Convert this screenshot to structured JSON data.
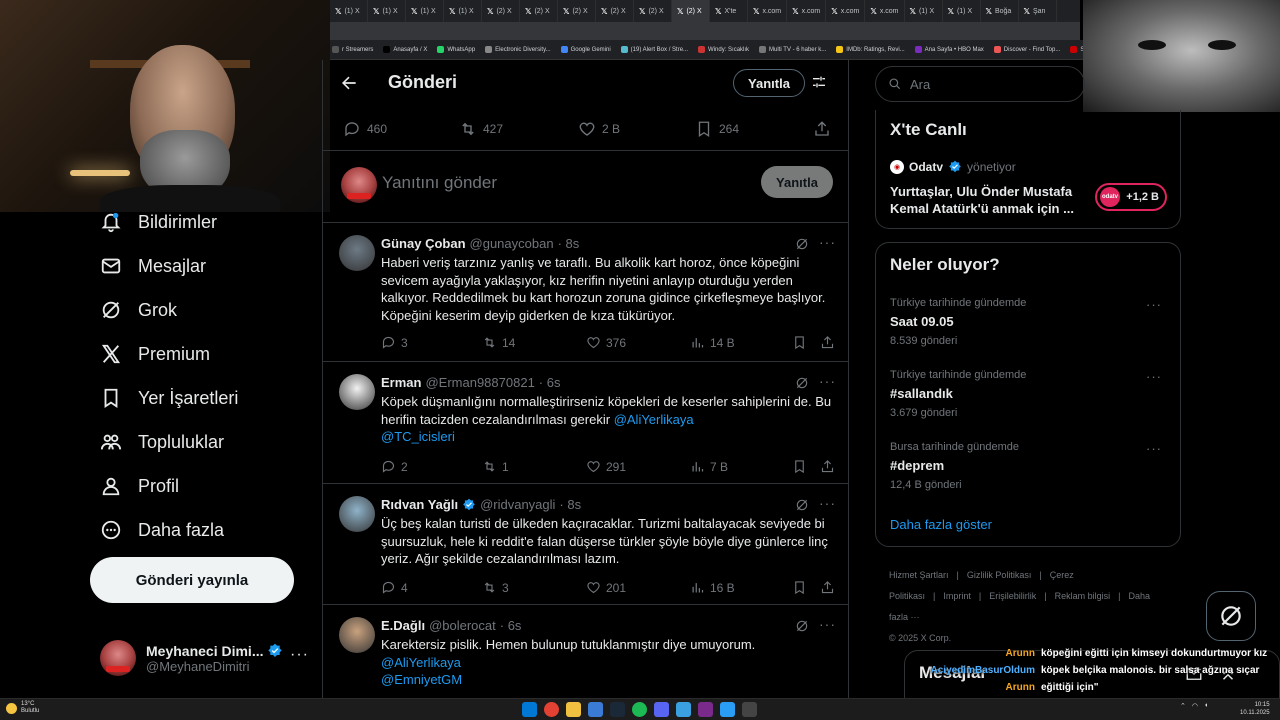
{
  "browser": {
    "tabs": [
      {
        "label": "(1) X",
        "active": false
      },
      {
        "label": "(1) X",
        "active": false
      },
      {
        "label": "(1) X",
        "active": false
      },
      {
        "label": "(1) X",
        "active": false
      },
      {
        "label": "(2) X",
        "active": false
      },
      {
        "label": "(2) X",
        "active": false
      },
      {
        "label": "(2) X",
        "active": false
      },
      {
        "label": "(2) X",
        "active": false
      },
      {
        "label": "(2) X",
        "active": false
      },
      {
        "label": "(2) X",
        "active": true
      },
      {
        "label": "X'te",
        "active": false
      },
      {
        "label": "x.com",
        "active": false
      },
      {
        "label": "x.com",
        "active": false
      },
      {
        "label": "x.com",
        "active": false
      },
      {
        "label": "x.com",
        "active": false
      },
      {
        "label": "(1) X",
        "active": false
      },
      {
        "label": "(1) X",
        "active": false
      },
      {
        "label": "Boğa",
        "active": false
      },
      {
        "label": "Şan",
        "active": false
      }
    ],
    "bookmarks": [
      {
        "label": "r Streamers",
        "color": "#555"
      },
      {
        "label": "Anasayfa / X",
        "color": "#000"
      },
      {
        "label": "WhatsApp",
        "color": "#25d366"
      },
      {
        "label": "Electronic Diversity...",
        "color": "#888"
      },
      {
        "label": "Google Gemini",
        "color": "#4285f4"
      },
      {
        "label": "(19) Alert Box / Stre...",
        "color": "#5bc"
      },
      {
        "label": "Windy: Sıcaklık",
        "color": "#c33"
      },
      {
        "label": "Multi TV - 6 haber k...",
        "color": "#777"
      },
      {
        "label": "IMDb: Ratings, Revi...",
        "color": "#f5c518"
      },
      {
        "label": "Ana Sayfa • HBO Max",
        "color": "#7b2cbf"
      },
      {
        "label": "Discover - Find Top...",
        "color": "#e55"
      },
      {
        "label": "SEÇİM S",
        "color": "#c00"
      }
    ]
  },
  "nav": {
    "items": [
      {
        "label": "Bildirimler",
        "icon": "bell-icon"
      },
      {
        "label": "Mesajlar",
        "icon": "mail-icon"
      },
      {
        "label": "Grok",
        "icon": "grok-icon"
      },
      {
        "label": "Premium",
        "icon": "x-logo-icon"
      },
      {
        "label": "Yer İşaretleri",
        "icon": "bookmark-icon"
      },
      {
        "label": "Topluluklar",
        "icon": "communities-icon"
      },
      {
        "label": "Profil",
        "icon": "profile-icon"
      },
      {
        "label": "Daha fazla",
        "icon": "more-circle-icon"
      }
    ],
    "post_button": "Gönderi yayınla",
    "account": {
      "name": "Meyhaneci Dimi...",
      "handle": "@MeyhaneDimitri"
    }
  },
  "header": {
    "title": "Gönderi",
    "reply_label": "Yanıtla"
  },
  "stats": {
    "replies": "460",
    "reposts": "427",
    "likes": "2 B",
    "bookmarks": "264"
  },
  "composer": {
    "placeholder": "Yanıtını gönder",
    "button": "Yanıtla"
  },
  "tweets": [
    {
      "name": "Günay Çoban",
      "handle": "@gunaycoban",
      "time": "· 8s",
      "verified": false,
      "text": "Haberi veriş tarzınız yanlış ve taraflı. Bu alkolik kart horoz, önce köpeğini sevicem ayağıyla yaklaşıyor, kız herifin niyetini anlayıp oturduğu yerden kalkıyor. Reddedilmek bu kart horozun zoruna gidince çirkefleşmeye başlıyor. Köpeğini keserim deyip giderken de kıza tükürüyor.",
      "mentions": [],
      "replies": "3",
      "reposts": "14",
      "likes": "376",
      "views": "14 B",
      "avatar_color": "#6d7a86"
    },
    {
      "name": "Erman",
      "handle": "@Erman98870821",
      "time": "· 6s",
      "verified": false,
      "text": "Köpek düşmanlığını normalleştirirseniz köpekleri de keserler sahiplerini de. Bu herifin tacizden cezalandırılması gerekir",
      "mentions": [
        "@AliYerlikaya",
        "@TC_icisleri"
      ],
      "replies": "2",
      "reposts": "1",
      "likes": "291",
      "views": "7 B",
      "avatar_color": "#f2f2f2"
    },
    {
      "name": "Rıdvan Yağlı",
      "handle": "@ridvanyagli",
      "time": "· 8s",
      "verified": true,
      "text": "Üç beş kalan turisti de ülkeden kaçıracaklar. Turizmi baltalayacak seviyede bi şuursuzluk, hele ki reddit'e falan düşerse türkler şöyle böyle diye günlerce linç yeriz. Ağır şekilde cezalandırılması lazım.",
      "mentions": [],
      "replies": "4",
      "reposts": "3",
      "likes": "201",
      "views": "16 B",
      "avatar_color": "#8fb3c9"
    },
    {
      "name": "E.Dağlı",
      "handle": "@bolerocat",
      "time": "· 6s",
      "verified": false,
      "text": "Karektersiz pislik. Hemen bulunup tutuklanmıştır diye umuyorum.",
      "mentions": [
        "@AliYerlikaya",
        "@EmniyetGM"
      ],
      "replies": "",
      "reposts": "",
      "likes": "",
      "views": "",
      "avatar_color": "#c9a27f"
    }
  ],
  "search": {
    "placeholder": "Ara"
  },
  "live": {
    "title": "X'te Canlı",
    "source": "Odatv",
    "role": "yönetiyor",
    "text": "Yurttaşlar, Ulu Önder Mustafa Kemal Atatürk'ü anmak için ...",
    "count": "+1,2 B",
    "logo_text": "odatv"
  },
  "trends": {
    "title": "Neler oluyor?",
    "items": [
      {
        "context": "Türkiye tarihinde gündemde",
        "title": "Saat 09.05",
        "count": "8.539 gönderi"
      },
      {
        "context": "Türkiye tarihinde gündemde",
        "title": "#sallandık",
        "count": "3.679 gönderi"
      },
      {
        "context": "Bursa tarihinde gündemde",
        "title": "#deprem",
        "count": "12,4 B gönderi"
      }
    ],
    "show_more": "Daha fazla göster"
  },
  "footer": {
    "links": [
      "Hizmet Şartları",
      "|",
      "Gizlilik Politikası",
      "|",
      "Çerez Politikası",
      "|",
      "Imprint",
      "|",
      "Erişilebilirlik",
      "|",
      "Reklam bilgisi",
      "|",
      "Daha fazla ···"
    ],
    "copyright": "© 2025 X Corp."
  },
  "messages_drawer": {
    "title": "Mesajlar"
  },
  "chat": [
    {
      "user": "Arunn",
      "msg": "köpeğini eğitti için kimseyi dokundurtmuyor kız",
      "color": "orange"
    },
    {
      "user": "AciyedimBasurOldum",
      "msg": "köpek belçika malonois. bir salsa ağzına sıçar",
      "color": "blue"
    },
    {
      "user": "Arunn",
      "msg": "eğittiği için\"",
      "color": "orange"
    }
  ],
  "taskbar": {
    "weather_temp": "13°C",
    "weather_desc": "Bulutlu",
    "time": "10:15",
    "date": "10.11.2025"
  }
}
